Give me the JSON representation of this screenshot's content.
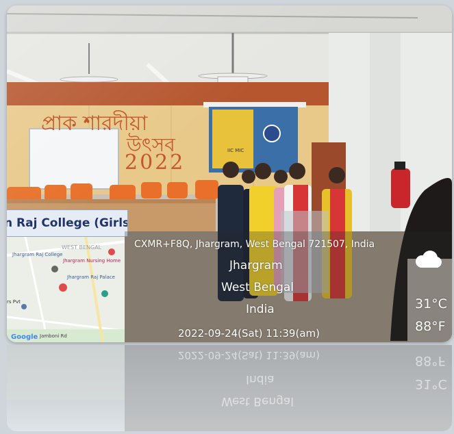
{
  "banner": {
    "college_name": "n Raj College (Girls Wing)"
  },
  "wall_text": {
    "line1": "প্রাক শারদীয়া",
    "line2": "উৎসব",
    "line3": "2022"
  },
  "projector": {
    "title": "IIC MIC"
  },
  "map": {
    "state_label": "WEST BENGAL",
    "places": [
      "Jhargram Raj College",
      "Jhargram Nursing Home",
      "Jhargram Raj Palace"
    ],
    "road_label": "Jamboni Rd",
    "partial_label": "rs Pvt",
    "logo": "Google"
  },
  "geo_stamp": {
    "plus_code": "CXMR+F8Q, Jhargram, West Bengal 721507, India",
    "city": "Jhargram",
    "state": "West Bengal",
    "country": "India",
    "temp_c": "31°C",
    "temp_f": "88°F",
    "datetime": "2022-09-24(Sat)  11:39(am)",
    "weather_icon": "cloud-icon"
  },
  "colors": {
    "wall_panel": "#e8c98a",
    "wall_brick": "#b5562e",
    "chairs": "#e8702a",
    "stamp_text": "#ffffff"
  }
}
